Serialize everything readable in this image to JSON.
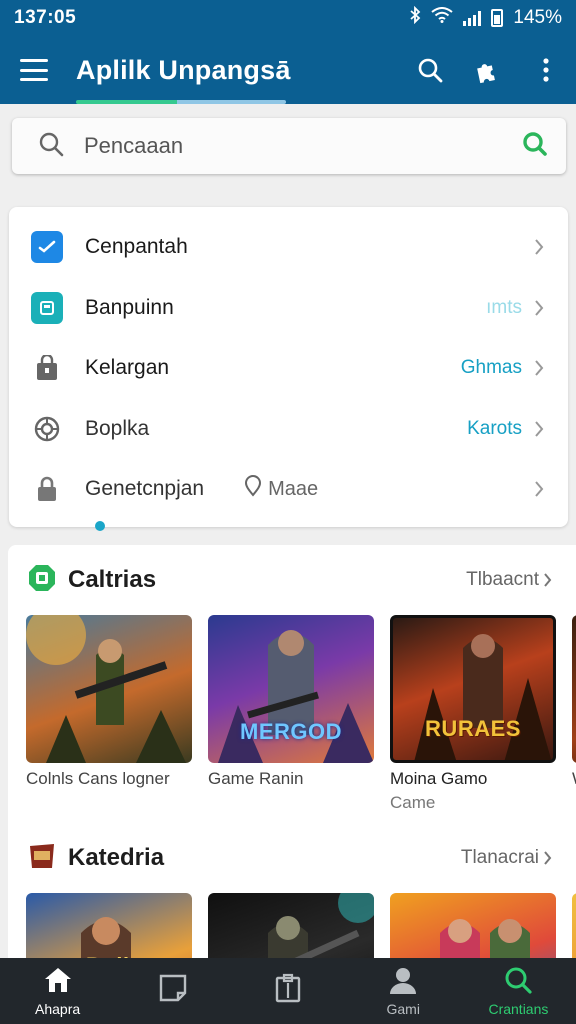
{
  "status": {
    "time": "137:05",
    "battery": "145%"
  },
  "appbar": {
    "title": "Aplilk Unpangsā"
  },
  "search": {
    "placeholder": "Pencaaan"
  },
  "settings": {
    "items": [
      {
        "label": "Cenpantah",
        "value": "",
        "icon": "check-app-icon"
      },
      {
        "label": "Banpuinn",
        "value": "ımts",
        "icon": "square-app-icon"
      },
      {
        "label": "Kelargan",
        "value": "Ghmas",
        "icon": "bag-icon"
      },
      {
        "label": "Boplka",
        "value": "Karots",
        "icon": "globe-icon"
      },
      {
        "label": "Genetcnpjan",
        "value": "",
        "note": "Maae",
        "icon": "lock-icon"
      }
    ]
  },
  "section1": {
    "title": "Caltrias",
    "more": "Tlbaacnt",
    "tiles": [
      {
        "caption": "Colnls Cans logner",
        "sub": "",
        "art_text": ""
      },
      {
        "caption": "Game Ranin",
        "sub": "",
        "art_text": "MERGOD"
      },
      {
        "caption": "Moina Gamo",
        "sub": "Came",
        "art_text": "RURAES"
      },
      {
        "caption": "W",
        "sub": "",
        "art_text": ""
      }
    ]
  },
  "section2": {
    "title": "Katedria",
    "more": "Tlanacrai",
    "tiles": [
      {
        "art_text": "Bolk"
      },
      {
        "art_text": ""
      },
      {
        "art_text": ""
      },
      {
        "art_text": ""
      }
    ]
  },
  "nav": {
    "items": [
      {
        "label": "Ahapra",
        "icon": "home-icon"
      },
      {
        "label": "",
        "icon": "chat-icon"
      },
      {
        "label": "",
        "icon": "clipboard-icon"
      },
      {
        "label": "Gami",
        "icon": "profile-icon"
      },
      {
        "label": "Crantians",
        "icon": "search-icon"
      }
    ]
  },
  "colors": {
    "primary": "#0b5f92",
    "accent": "#17a0c4",
    "green": "#2ecc71",
    "nav_bg": "#22272c"
  }
}
